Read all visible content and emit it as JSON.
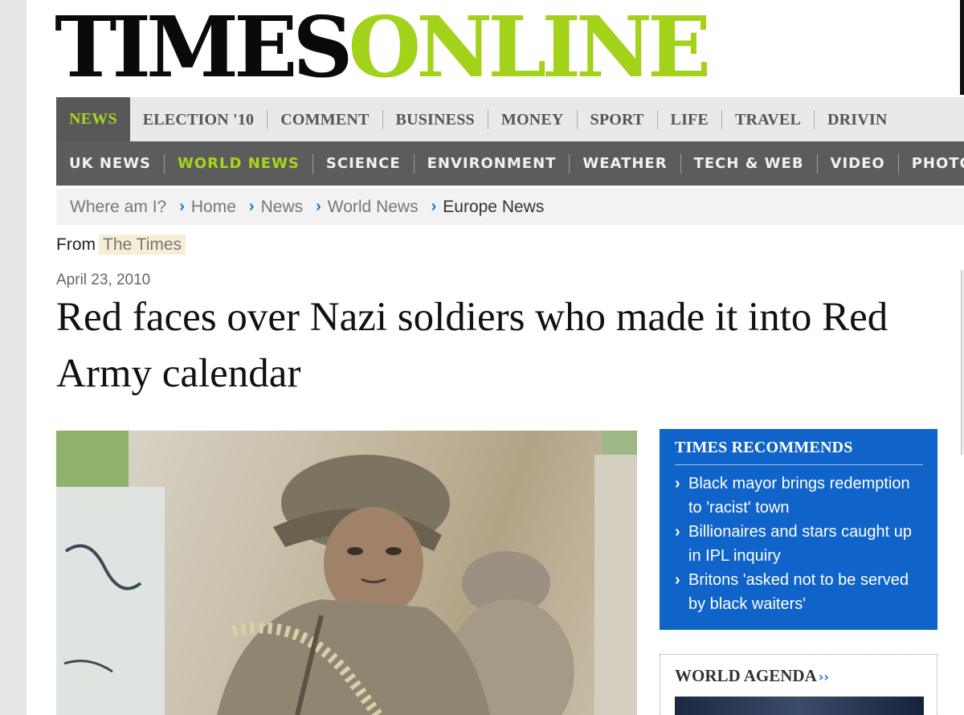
{
  "logo": {
    "part1": "TIMES",
    "part2": "ONLINE"
  },
  "nav_primary": [
    {
      "label": "NEWS",
      "active": true
    },
    {
      "label": "ELECTION '10"
    },
    {
      "label": "COMMENT"
    },
    {
      "label": "BUSINESS"
    },
    {
      "label": "MONEY"
    },
    {
      "label": "SPORT"
    },
    {
      "label": "LIFE"
    },
    {
      "label": "TRAVEL"
    },
    {
      "label": "DRIVIN"
    }
  ],
  "nav_secondary": [
    {
      "label": "UK NEWS"
    },
    {
      "label": "WORLD NEWS",
      "active": true
    },
    {
      "label": "SCIENCE"
    },
    {
      "label": "ENVIRONMENT"
    },
    {
      "label": "WEATHER"
    },
    {
      "label": "TECH & WEB"
    },
    {
      "label": "VIDEO"
    },
    {
      "label": "PHOTO"
    }
  ],
  "breadcrumb": {
    "lead": "Where am I?",
    "items": [
      "Home",
      "News",
      "World News"
    ],
    "current": "Europe News"
  },
  "article": {
    "from_label": "From",
    "source": "The Times",
    "date": "April 23, 2010",
    "headline": "Red faces over Nazi soldiers who made it into Red Army calendar"
  },
  "recommends": {
    "title": "TIMES RECOMMENDS",
    "items": [
      "Black mayor brings redemption to 'racist' town",
      "Billionaires and stars caught up in IPL inquiry",
      "Britons 'asked not to be served by black waiters'"
    ]
  },
  "agenda": {
    "title": "WORLD AGENDA",
    "arrows": "››"
  },
  "colors": {
    "brand_green": "#a2d21a",
    "nav_dark": "#5c5c5c",
    "recommends_blue": "#0f63c9",
    "link_blue": "#1874c8"
  },
  "icons": {
    "breadcrumb_separator": "chevron-right-icon",
    "recommend_bullet": "chevron-right-icon",
    "agenda_arrows": "double-chevron-right-icon"
  }
}
